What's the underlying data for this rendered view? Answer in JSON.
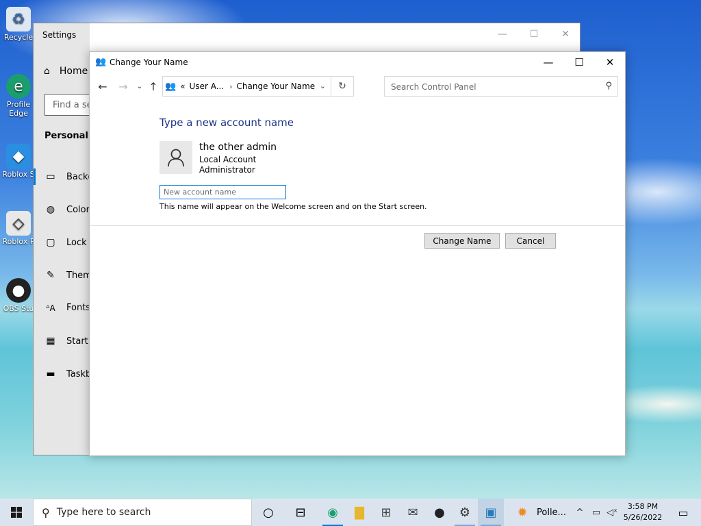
{
  "desktop": {
    "icons": [
      {
        "label": "Recycle",
        "icon": "recycle-bin-icon"
      },
      {
        "label": "Profile Edge",
        "icon": "edge-icon"
      },
      {
        "label": "Roblox S",
        "icon": "roblox-studio-icon"
      },
      {
        "label": "Roblox P",
        "icon": "roblox-player-icon"
      },
      {
        "label": "OBS Stu",
        "icon": "obs-icon"
      }
    ]
  },
  "settings": {
    "title": "Settings",
    "home": "Home",
    "find_placeholder": "Find a se",
    "section": "Personaliza",
    "nav": [
      "Backg",
      "Colors",
      "Lock s",
      "Them",
      "Fonts",
      "Start",
      "Taskb"
    ]
  },
  "dialog": {
    "title": "Change Your Name",
    "breadcrumb": {
      "parent": "User A...",
      "current": "Change Your Name",
      "prefix": "«"
    },
    "search_placeholder": "Search Control Panel",
    "heading": "Type a new account name",
    "account": {
      "name": "the other admin",
      "type": "Local Account",
      "role": "Administrator"
    },
    "input_placeholder": "New account name",
    "hint": "This name will appear on the Welcome screen and on the Start screen.",
    "buttons": {
      "change": "Change Name",
      "cancel": "Cancel"
    }
  },
  "taskbar": {
    "search_placeholder": "Type here to search",
    "pinned_label": "Polle...",
    "time": "3:58 PM",
    "date": "5/26/2022"
  },
  "colors": {
    "accent": "#0078d7",
    "heading": "#1e3287",
    "taskbar": "#dbe4ee"
  }
}
